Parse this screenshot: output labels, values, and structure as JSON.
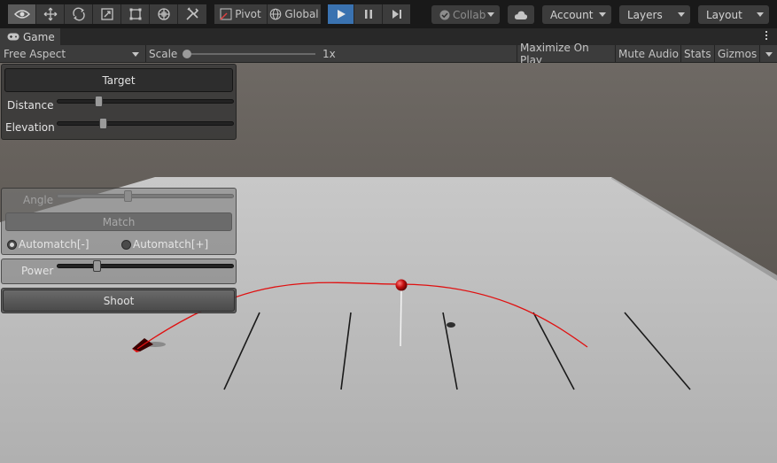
{
  "toolbar": {
    "tools": [
      {
        "icon": "view-tool-icon",
        "active": true
      },
      {
        "icon": "move-tool-icon",
        "active": false
      },
      {
        "icon": "rotate-tool-icon",
        "active": false
      },
      {
        "icon": "scale-tool-icon",
        "active": false
      },
      {
        "icon": "rect-tool-icon",
        "active": false
      },
      {
        "icon": "transform-tool-icon",
        "active": false
      },
      {
        "icon": "custom-tools-icon",
        "active": false
      }
    ],
    "pivot_label": "Pivot",
    "global_label": "Global",
    "play_icon": "play-icon",
    "pause_icon": "pause-icon",
    "step_icon": "step-icon",
    "play_active": true,
    "collab_label": "Collab",
    "cloud_icon": "cloud-icon",
    "account_label": "Account",
    "layers_label": "Layers",
    "layout_label": "Layout",
    "accent_color": "#3a72b0"
  },
  "game_tab": {
    "label": "Game",
    "icon": "gamepad-icon",
    "menu_icon": "kebab-menu-icon"
  },
  "game_bar": {
    "aspect": "Free Aspect",
    "scale_label": "Scale",
    "scale_value": "1x",
    "scale_level": 0,
    "maximize_label": "Maximize On Play",
    "mute_label": "Mute Audio",
    "stats_label": "Stats",
    "gizmos_label": "Gizmos"
  },
  "gui": {
    "target_label": "Target",
    "distance_label": "Distance",
    "distance_level": 0.23,
    "elevation_label": "Elevation",
    "elevation_level": 0.26,
    "angle_label": "Angle",
    "angle_level": 0.4,
    "match_label": "Match",
    "automatch_minus_label": "Automatch[-]",
    "automatch_plus_label": "Automatch[+]",
    "automatch_minus_selected": true,
    "automatch_plus_selected": false,
    "power_label": "Power",
    "power_level": 0.22,
    "shoot_label": "Shoot"
  },
  "scene_colors": {
    "sky": "#57504a",
    "floor": "#b6b6b6",
    "trajectory": "#e01010",
    "ball": "#c41010"
  }
}
